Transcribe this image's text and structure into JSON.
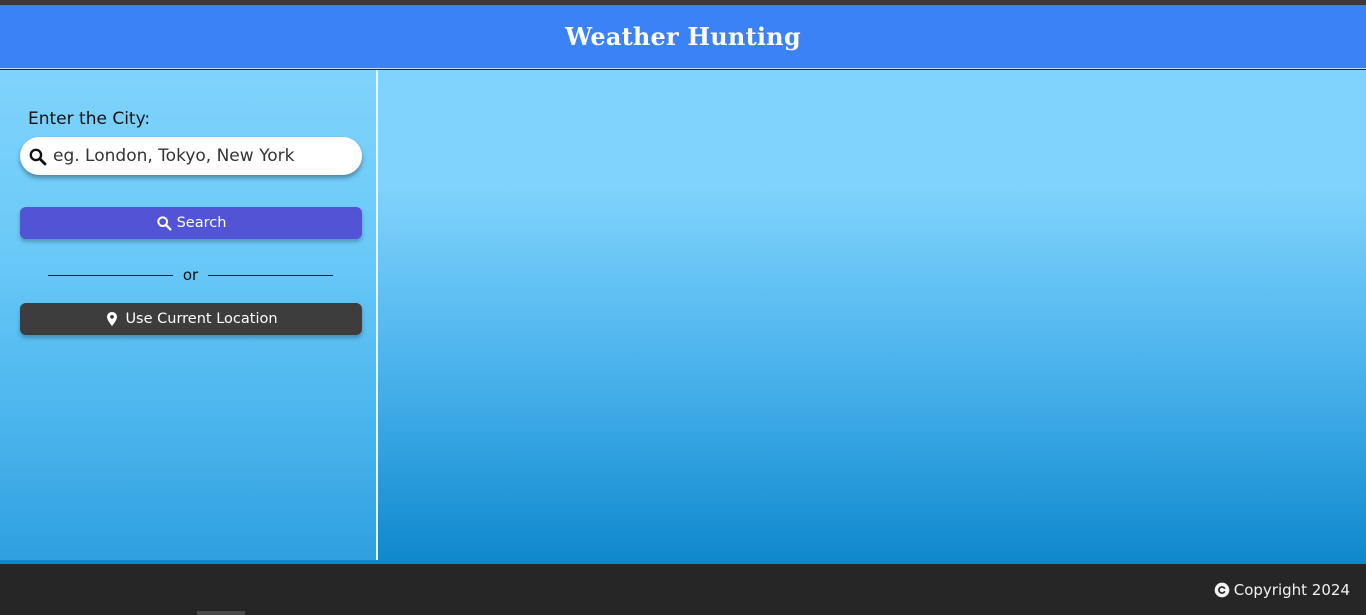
{
  "header": {
    "title": "Weather Hunting"
  },
  "sidebar": {
    "city_label": "Enter the City:",
    "search_input": {
      "placeholder": "eg. London, Tokyo, New York",
      "value": ""
    },
    "search_button": {
      "label": "Search",
      "icon": "search-icon"
    },
    "divider_text": "or",
    "location_button": {
      "label": "Use Current Location",
      "icon": "map-pin-icon"
    }
  },
  "footer": {
    "copyright": "Copyright 2024",
    "icon": "copyright-icon"
  },
  "colors": {
    "header_bg": "#3b82f6",
    "search_button_bg": "#5353d6",
    "location_button_bg": "#3d3d3d",
    "footer_bg": "#262626"
  }
}
